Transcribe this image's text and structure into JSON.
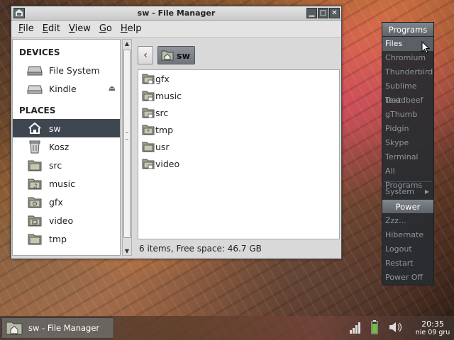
{
  "window": {
    "title": "sw - File Manager",
    "buttons": {
      "minimize": "▁",
      "maximize": "□",
      "close": "✕"
    }
  },
  "menu": [
    "File",
    "Edit",
    "View",
    "Go",
    "Help"
  ],
  "sidebar": {
    "devices_heading": "DEVICES",
    "devices": [
      {
        "label": "File System",
        "icon": "drive-icon"
      },
      {
        "label": "Kindle",
        "icon": "removable-drive-icon",
        "eject": "⏏"
      }
    ],
    "places_heading": "PLACES",
    "places": [
      {
        "label": "sw",
        "icon": "home-icon",
        "selected": true
      },
      {
        "label": "Kosz",
        "icon": "trash-icon"
      },
      {
        "label": "src",
        "icon": "folder-icon"
      },
      {
        "label": "music",
        "icon": "music-folder-icon"
      },
      {
        "label": "gfx",
        "icon": "pictures-folder-icon"
      },
      {
        "label": "video",
        "icon": "video-folder-icon"
      },
      {
        "label": "tmp",
        "icon": "folder-icon"
      }
    ]
  },
  "pathbar": {
    "back": "‹",
    "current": "sw"
  },
  "files": [
    "gfx",
    "music",
    "src",
    "tmp",
    "usr",
    "video"
  ],
  "status": "6 items, Free space: 46.7 GB",
  "launcher": {
    "programs_heading": "Programs",
    "programs": [
      "Files",
      "Chromium",
      "Thunderbird",
      "Sublime Text",
      "Deadbeef",
      "gThumb",
      "Pidgin",
      "Skype",
      "Terminal",
      "All Programs"
    ],
    "system": "System",
    "power_heading": "Power",
    "power": [
      "Zzz...",
      "Hibernate",
      "Logout",
      "Restart",
      "Power Off"
    ]
  },
  "taskbar": {
    "task_label": "sw - File Manager",
    "time": "20:35",
    "date": "nie 09 gru"
  },
  "colors": {
    "selection": "#3e4750",
    "panel": "#282c30"
  }
}
